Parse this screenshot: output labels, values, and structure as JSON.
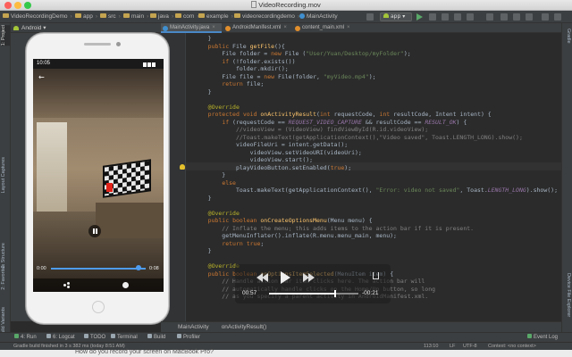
{
  "window": {
    "title": "VideoRecording.mov"
  },
  "navbar": {
    "crumbs": [
      "VideoRecordingDemo",
      "app",
      "src",
      "main",
      "java",
      "com",
      "example",
      "videorecordingdemo",
      "MainActivity"
    ],
    "run_config": "app"
  },
  "project_pane": {
    "view": "Android"
  },
  "tabs": [
    {
      "label": "MainActivity.java",
      "color": "#3f8fcf"
    },
    {
      "label": "AndroidManifest.xml",
      "color": "#e08e2c"
    },
    {
      "label": "content_main.xml",
      "color": "#e08e2c"
    }
  ],
  "left_tools": [
    "1: Project",
    "Layout Captures",
    "2: Structure",
    "2: Favorites",
    "Build Variants"
  ],
  "right_tools": [
    "Gradle",
    "Device File Explorer"
  ],
  "phone": {
    "clock": "10:05",
    "video_elapsed": "0:00",
    "video_total": "0:08",
    "video_progress": 0.92
  },
  "editor": {
    "lines": [
      "    }",
      "    public File getFile(){",
      "        File folder = new File (\"User/Yuan/Desktop/myFolder\");",
      "        if (!folder.exists())",
      "            folder.mkdir();",
      "        File file = new File(folder, \"myVideo.mp4\");",
      "        return file;",
      "    }",
      "",
      "    @Override",
      "    protected void onActivityResult(int requestCode, int resultCode, Intent intent) {",
      "        if (requestCode == REQUEST_VIDEO_CAPTURE && resultCode == RESULT_OK) {",
      "            //videoView = (VideoView) findViewById(R.id.videoView);",
      "            //Toast.makeText(getApplicationContext(),\"Video saved\", Toast.LENGTH_LONG).show();",
      "            videoFileUri = intent.getData();",
      "                videoView.setVideoURI(videoUri);",
      "                videoView.start();",
      "            playVideoButton.setEnabled(true);",
      "        }",
      "        else",
      "            Toast.makeText(getApplicationContext(), \"Error: video not saved\", Toast.LENGTH_LONG).show();",
      "    }",
      "",
      "    @Override",
      "    public boolean onCreateOptionsMenu(Menu menu) {",
      "        // Inflate the menu; this adds items to the action bar if it is present.",
      "        getMenuInflater().inflate(R.menu.menu_main, menu);",
      "        return true;",
      "    }",
      "",
      "    @Override",
      "    public boolean onOptionsItemSelected(MenuItem item) {",
      "        // Handle action bar item clicks here. The action bar will",
      "        // automatically handle clicks on the Home/Up button, so long",
      "        // as you specify a parent activity in AndroidManifest.xml.",
      "",
      "",
      "",
      "",
      "            return true;",
      "",
      "",
      "        return super.onOptionsItemSelected(item);"
    ]
  },
  "quicktime": {
    "elapsed": "00:57",
    "remaining": "-00:21",
    "progress": 0.73
  },
  "editor_crumbs": [
    "MainActivity",
    "onActivityResult()"
  ],
  "bottom_tools": [
    {
      "label": "4: Run",
      "color": "#59a869"
    },
    {
      "label": "6: Logcat",
      "color": "#9aa7b0"
    },
    {
      "label": "TODO",
      "color": "#9aa7b0"
    },
    {
      "label": "Terminal",
      "color": "#9aa7b0"
    },
    {
      "label": "Build",
      "color": "#9aa7b0"
    },
    {
      "label": "Profiler",
      "color": "#9aa7b0"
    },
    {
      "label": "Event Log",
      "color": "#59a869"
    }
  ],
  "statusbar": {
    "message": "Gradle build finished in 3 s 382 ms (today 8:51 AM)",
    "position": "113:10",
    "line_sep": "LF",
    "encoding": "UTF-8",
    "context": "Context: <no context>"
  },
  "below_window": {
    "text": "How do you record your screen on MacBook Pro?"
  }
}
